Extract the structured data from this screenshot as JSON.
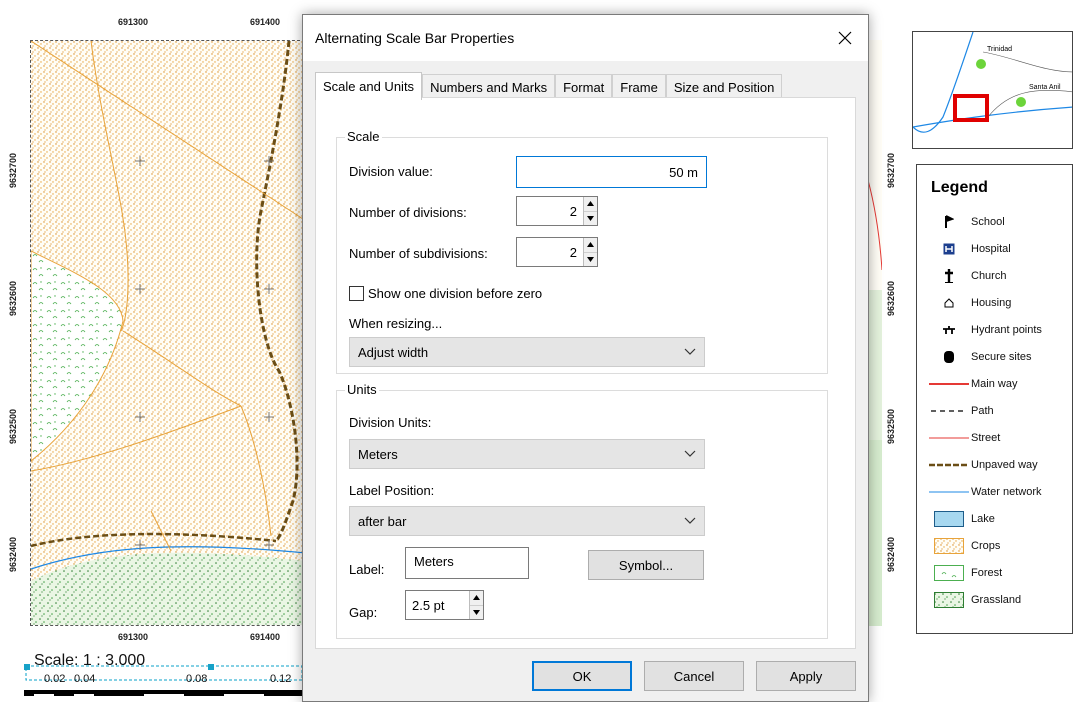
{
  "dialog": {
    "title": "Alternating Scale Bar Properties",
    "tabs": [
      "Scale and Units",
      "Numbers and Marks",
      "Format",
      "Frame",
      "Size and Position"
    ],
    "active_tab": "Scale and Units",
    "scale_group": {
      "title": "Scale",
      "division_value_label": "Division value:",
      "division_value": "50 m",
      "num_divisions_label": "Number of divisions:",
      "num_divisions": "2",
      "num_subdivisions_label": "Number of subdivisions:",
      "num_subdivisions": "2",
      "show_one_division_label": "Show one division before zero",
      "show_one_division_checked": false,
      "when_resizing_label": "When resizing...",
      "when_resizing_value": "Adjust width"
    },
    "units_group": {
      "title": "Units",
      "division_units_label": "Division Units:",
      "division_units_value": "Meters",
      "label_position_label": "Label Position:",
      "label_position_value": "after bar",
      "label_label": "Label:",
      "label_value": "Meters",
      "symbol_button": "Symbol...",
      "gap_label": "Gap:",
      "gap_value": "2.5 pt"
    },
    "buttons": {
      "ok": "OK",
      "cancel": "Cancel",
      "apply": "Apply"
    }
  },
  "map": {
    "top_coords": [
      "691300",
      "691400"
    ],
    "bottom_coords": [
      "691300",
      "691400"
    ],
    "left_coords": [
      "9632700",
      "9632600",
      "9632500",
      "9632400"
    ],
    "right_coords": [
      "9632700",
      "9632600",
      "9632500",
      "9632400"
    ],
    "scale_text": "Scale:  1 : 3.000",
    "scale_ticks": [
      "0.02",
      "0.04",
      "0.08",
      "0.12"
    ]
  },
  "overview": {
    "labels": [
      "Trinidad",
      "Santa Anil"
    ]
  },
  "legend": {
    "title": "Legend",
    "items": [
      {
        "label": "School",
        "icon": "school-icon"
      },
      {
        "label": "Hospital",
        "icon": "hospital-icon"
      },
      {
        "label": "Church",
        "icon": "church-icon"
      },
      {
        "label": "Housing",
        "icon": "housing-icon"
      },
      {
        "label": "Hydrant points",
        "icon": "hydrant-icon"
      },
      {
        "label": "Secure sites",
        "icon": "secure-site-icon"
      },
      {
        "label": "Main way",
        "icon": "main-way-line"
      },
      {
        "label": "Path",
        "icon": "path-line"
      },
      {
        "label": "Street",
        "icon": "street-line"
      },
      {
        "label": "Unpaved way",
        "icon": "unpaved-way-line"
      },
      {
        "label": "Water network",
        "icon": "water-network-line"
      },
      {
        "label": "Lake",
        "icon": "lake-patch"
      },
      {
        "label": "Crops",
        "icon": "crops-patch"
      },
      {
        "label": "Forest",
        "icon": "forest-patch"
      },
      {
        "label": "Grassland",
        "icon": "grassland-patch"
      }
    ]
  },
  "colors": {
    "focus_blue": "#0078d7",
    "crops": "#e8a33a",
    "grassland": "#4caf50",
    "main_way": "#e53935",
    "unpaved": "#6b4e16",
    "water": "#1e88e5"
  }
}
